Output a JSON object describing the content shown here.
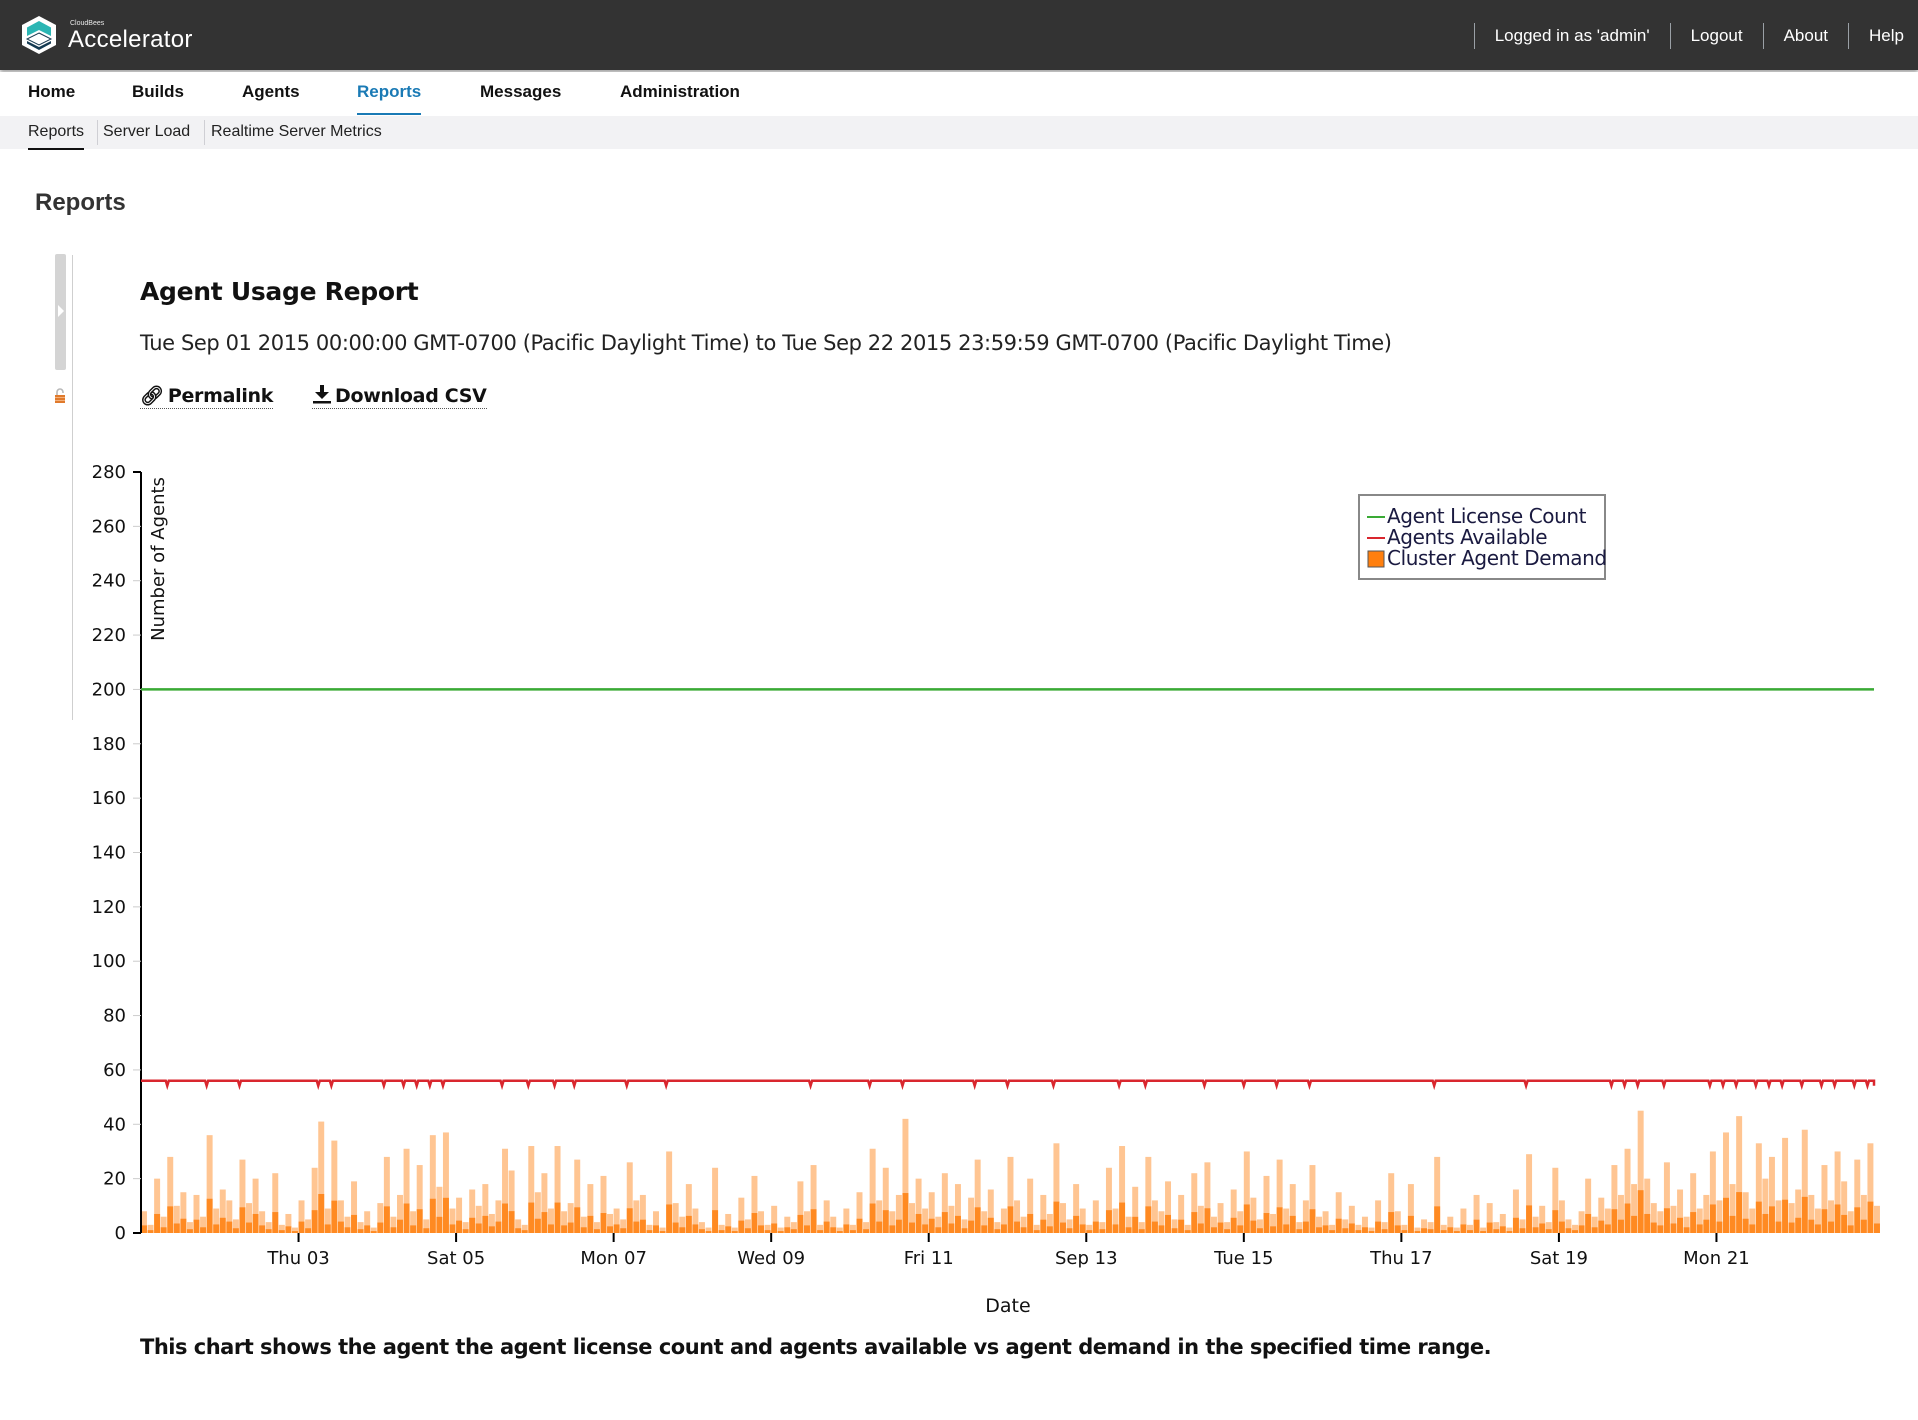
{
  "header": {
    "brand_small": "CloudBees",
    "brand": "Accelerator",
    "user_menu": [
      "Logged in as 'admin'",
      "Logout",
      "About",
      "Help"
    ]
  },
  "nav": {
    "main": [
      {
        "label": "Home",
        "active": false
      },
      {
        "label": "Builds",
        "active": false
      },
      {
        "label": "Agents",
        "active": false
      },
      {
        "label": "Reports",
        "active": true
      },
      {
        "label": "Messages",
        "active": false
      },
      {
        "label": "Administration",
        "active": false
      }
    ],
    "sub": [
      {
        "label": "Reports",
        "active": true
      },
      {
        "label": "Server Load",
        "active": false
      },
      {
        "label": "Realtime Server Metrics",
        "active": false
      }
    ]
  },
  "page": {
    "title": "Reports",
    "report_title": "Agent Usage Report",
    "date_range": "Tue Sep 01 2015 00:00:00 GMT-0700 (Pacific Daylight Time) to Tue Sep 22 2015 23:59:59 GMT-0700 (Pacific Daylight Time)",
    "permalink_label": "Permalink",
    "download_label": "Download CSV",
    "footnote": "This chart shows the agent the agent license count and agents available vs agent demand in the specified time range."
  },
  "colors": {
    "license": "#3aaa35",
    "available": "#d9262e",
    "demand": "#ff7f0e",
    "accent": "#1a7ab5"
  },
  "chart_data": {
    "type": "area",
    "title": "",
    "xlabel": "Date",
    "ylabel": "Number of Agents",
    "ylim": [
      0,
      280
    ],
    "yticks": [
      0,
      20,
      40,
      60,
      80,
      100,
      120,
      140,
      160,
      180,
      200,
      220,
      240,
      260,
      280
    ],
    "x_range_days": [
      0,
      22
    ],
    "x_start": "Sep 01 2015",
    "xticks": [
      {
        "day": 2,
        "label": "Thu 03"
      },
      {
        "day": 4,
        "label": "Sat 05"
      },
      {
        "day": 6,
        "label": "Mon 07"
      },
      {
        "day": 8,
        "label": "Wed 09"
      },
      {
        "day": 10,
        "label": "Fri 11"
      },
      {
        "day": 12,
        "label": "Sep 13"
      },
      {
        "day": 14,
        "label": "Tue 15"
      },
      {
        "day": 16,
        "label": "Thu 17"
      },
      {
        "day": 18,
        "label": "Sat 19"
      },
      {
        "day": 20,
        "label": "Mon 21"
      }
    ],
    "legend": {
      "position": "top-right",
      "entries": [
        "Agent License Count",
        "Agents Available",
        "Cluster Agent Demand"
      ]
    },
    "series": [
      {
        "name": "Agent License Count",
        "type": "line",
        "constant": 200
      },
      {
        "name": "Agents Available",
        "type": "line",
        "constant": 56,
        "dips_to": 55
      },
      {
        "name": "Cluster Agent Demand",
        "type": "bar",
        "sample_interval_hours": 2,
        "values": [
          8,
          3,
          20,
          6,
          28,
          10,
          15,
          4,
          14,
          6,
          36,
          9,
          16,
          12,
          5,
          27,
          11,
          20,
          8,
          4,
          22,
          3,
          7,
          2,
          12,
          5,
          24,
          41,
          9,
          34,
          12,
          6,
          19,
          4,
          8,
          2,
          11,
          28,
          6,
          14,
          31,
          8,
          25,
          5,
          36,
          17,
          37,
          9,
          13,
          4,
          16,
          10,
          18,
          7,
          12,
          31,
          23,
          5,
          3,
          32,
          15,
          22,
          9,
          32,
          8,
          11,
          27,
          6,
          18,
          4,
          21,
          7,
          9,
          5,
          26,
          12,
          14,
          3,
          8,
          2,
          30,
          11,
          6,
          18,
          9,
          4,
          2,
          24,
          3,
          7,
          2,
          13,
          5,
          21,
          8,
          3,
          10,
          2,
          6,
          4,
          19,
          8,
          25,
          3,
          12,
          6,
          2,
          9,
          3,
          15,
          4,
          31,
          12,
          24,
          8,
          14,
          42,
          11,
          20,
          9,
          15,
          6,
          22,
          10,
          18,
          5,
          13,
          27,
          8,
          16,
          4,
          9,
          28,
          12,
          6,
          20,
          3,
          14,
          7,
          33,
          11,
          5,
          18,
          9,
          3,
          12,
          4,
          24,
          9,
          32,
          6,
          17,
          4,
          28,
          12,
          8,
          19,
          5,
          14,
          3,
          22,
          10,
          26,
          6,
          11,
          4,
          16,
          8,
          30,
          13,
          5,
          21,
          7,
          27,
          9,
          18,
          4,
          12,
          25,
          6,
          8,
          3,
          15,
          5,
          10,
          3,
          6,
          2,
          12,
          4,
          22,
          8,
          3,
          18,
          2,
          5,
          4,
          28,
          3,
          6,
          2,
          9,
          3,
          14,
          2,
          11,
          4,
          7,
          2,
          16,
          5,
          29,
          6,
          10,
          4,
          24,
          12,
          5,
          3,
          8,
          20,
          6,
          13,
          9,
          25,
          14,
          31,
          18,
          45,
          20,
          11,
          8,
          26,
          10,
          16,
          6,
          22,
          9,
          14,
          30,
          12,
          37,
          18,
          43,
          15,
          9,
          33,
          20,
          28,
          12,
          35,
          11,
          16,
          38,
          14,
          9,
          25,
          12,
          30,
          19,
          8,
          27,
          14,
          33,
          10,
          17,
          26,
          9,
          45,
          15,
          11,
          22,
          7,
          29,
          13,
          18,
          36,
          9,
          12,
          24,
          6,
          15,
          33,
          10,
          8,
          20,
          14,
          27,
          5,
          11,
          16,
          6,
          26,
          9,
          37,
          13,
          6,
          21,
          3,
          14,
          8,
          29,
          5,
          10,
          4,
          13,
          27,
          6,
          9,
          3,
          16,
          5,
          22,
          4,
          8,
          2,
          26,
          11,
          6,
          18,
          4,
          14,
          3,
          20,
          7,
          12,
          5,
          9,
          16,
          25,
          11,
          30,
          18,
          14,
          36,
          20,
          9,
          17,
          12,
          28,
          15,
          26,
          8,
          21,
          13,
          34,
          19,
          24,
          10,
          30,
          23,
          28,
          36,
          17,
          25,
          33,
          22,
          30,
          38,
          14,
          26
        ]
      }
    ]
  }
}
